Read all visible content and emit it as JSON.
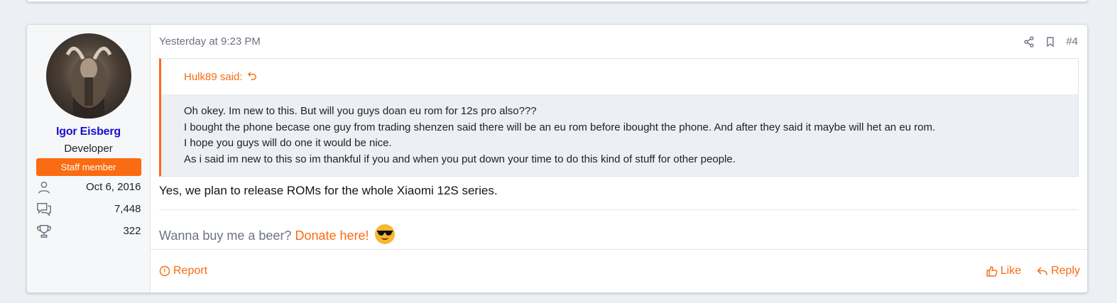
{
  "post": {
    "number": "#4",
    "date": "Yesterday at 9:23 PM",
    "author": {
      "name": "Igor Eisberg",
      "title": "Developer",
      "badge": "Staff member",
      "stats": [
        {
          "icon": "user-icon",
          "value": "Oct 6, 2016"
        },
        {
          "icon": "messages-icon",
          "value": "7,448"
        },
        {
          "icon": "trophy-icon",
          "value": "322"
        }
      ]
    },
    "quote": {
      "attribution": "Hulk89 said:",
      "lines": [
        "Oh okey. Im new to this. But will you guys doan eu rom for 12s pro also???",
        "I bought the phone becase one guy from trading shenzen said there will be an eu rom before ibought the phone. And after they said it maybe will het an eu rom.",
        "I hope you guys will do one it would be nice.",
        "As i said im new to this so im thankful if you and when you put down your time to do this kind of stuff for other people."
      ]
    },
    "body": "Yes, we plan to release ROMs for the whole Xiaomi 12S series.",
    "signature": {
      "prefix": "Wanna buy me a beer?",
      "link": "Donate here!"
    },
    "footer": {
      "report": "Report",
      "like": "Like",
      "reply": "Reply"
    }
  },
  "colors": {
    "accent": "#fa6b12",
    "username": "#1a0dcc",
    "muted": "#6c7480"
  }
}
